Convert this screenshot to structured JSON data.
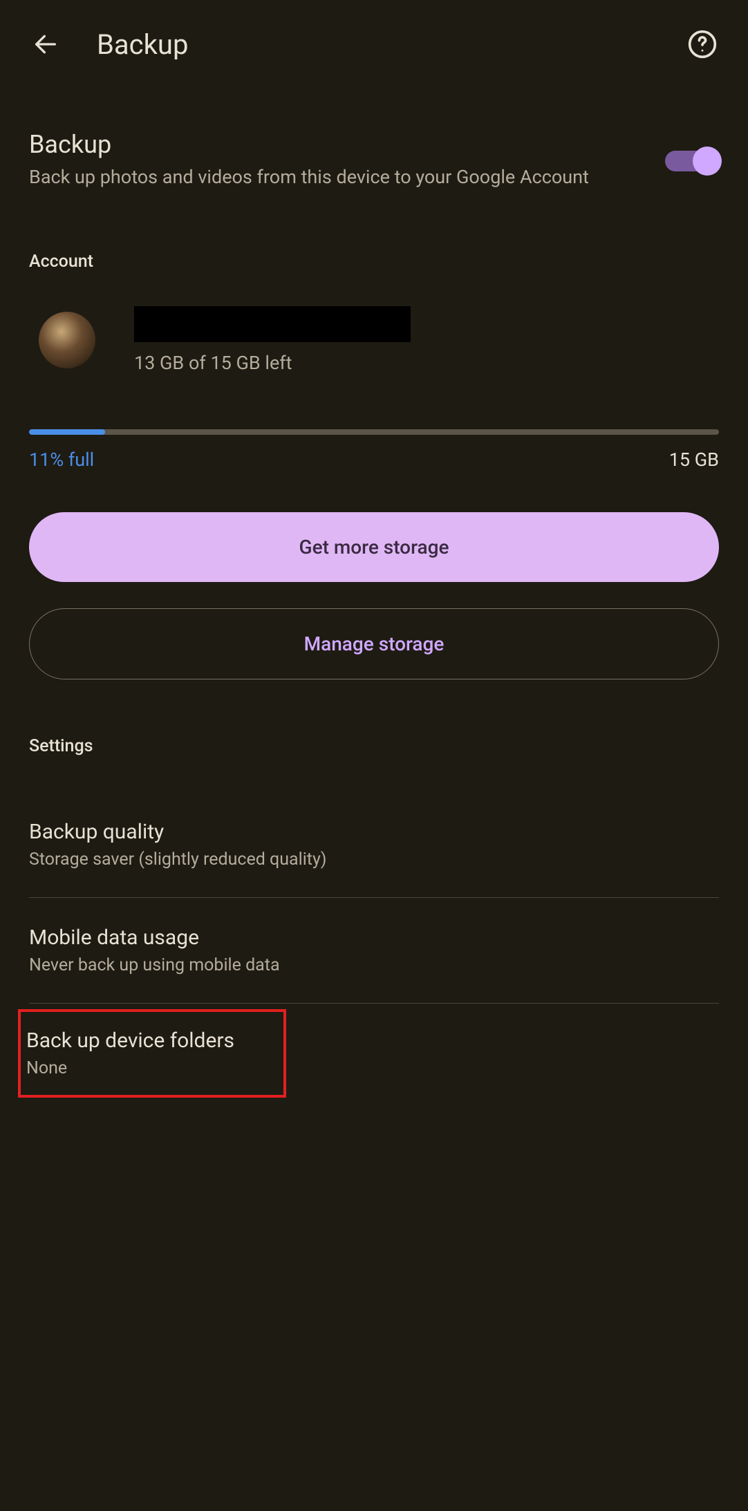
{
  "header": {
    "title": "Backup"
  },
  "backup_toggle": {
    "title": "Backup",
    "description": "Back up photos and videos from this device to your Google Account",
    "enabled": true
  },
  "account_section": {
    "label": "Account",
    "storage_left": "13 GB of 15 GB left"
  },
  "storage": {
    "percent_label": "11% full",
    "percent_value": 11,
    "total_label": "15 GB"
  },
  "buttons": {
    "get_more": "Get more storage",
    "manage": "Manage storage"
  },
  "settings": {
    "label": "Settings",
    "items": [
      {
        "title": "Backup quality",
        "value": "Storage saver (slightly reduced quality)"
      },
      {
        "title": "Mobile data usage",
        "value": "Never back up using mobile data"
      },
      {
        "title": "Back up device folders",
        "value": "None"
      }
    ]
  }
}
